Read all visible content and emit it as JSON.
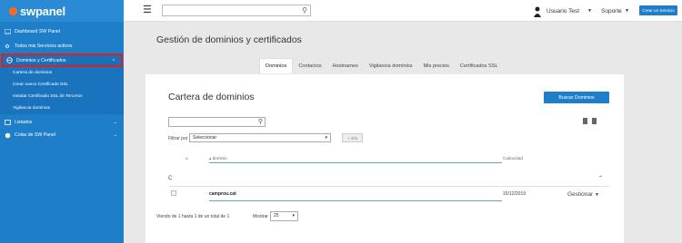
{
  "brand": {
    "name": "swpanel",
    "logo_color": "#ff6a1a",
    "accent": "#1e7ec8"
  },
  "sidebar": {
    "items": [
      {
        "label": "Dashboard SW Panel",
        "icon": "dashboard-icon"
      },
      {
        "label": "Todos mis Servicios activos",
        "icon": "gear-icon"
      },
      {
        "label": "Dominios y Certificados",
        "icon": "globe-icon",
        "expanded": true
      },
      {
        "label": "Listados",
        "icon": "list-icon"
      },
      {
        "label": "Colas de SW Panel",
        "icon": "queue-icon"
      }
    ],
    "subitems": [
      {
        "label": "Cartera de dominios"
      },
      {
        "label": "Crear nuevo Certificado SSL"
      },
      {
        "label": "Instalar Certificado SSL de Terceros"
      },
      {
        "label": "Vigilancia dominios"
      }
    ]
  },
  "topbar": {
    "search_placeholder": "",
    "user_name": "Usuario Test",
    "support_label": "Soporte",
    "create_service_label": "Crear un Servicio"
  },
  "page": {
    "title": "Gestión de dominios y certificados"
  },
  "tabs": [
    {
      "label": "Dominios",
      "active": true
    },
    {
      "label": "Contactos"
    },
    {
      "label": "Hostnames"
    },
    {
      "label": "Vigilancia dominios"
    },
    {
      "label": "Mis precios"
    },
    {
      "label": "Certificados SSL"
    }
  ],
  "card": {
    "title": "Cartera de dominios",
    "search_button": "Buscar Dominios",
    "filter_label": "Filtrar por",
    "filter_value": "Seleccionar",
    "info_button": "+ info",
    "columns": {
      "u": "u",
      "domain": "▴ dominio",
      "expires": "Caducidad"
    },
    "group_label": "C",
    "rows": [
      {
        "domain": "camprou.cat",
        "expires": "15/12/2019",
        "action": "Gestionar"
      }
    ],
    "footer_text": "Viendo de 1 hasta 1 de un total de 1",
    "show_label": "Mostrar",
    "show_value": "25"
  }
}
